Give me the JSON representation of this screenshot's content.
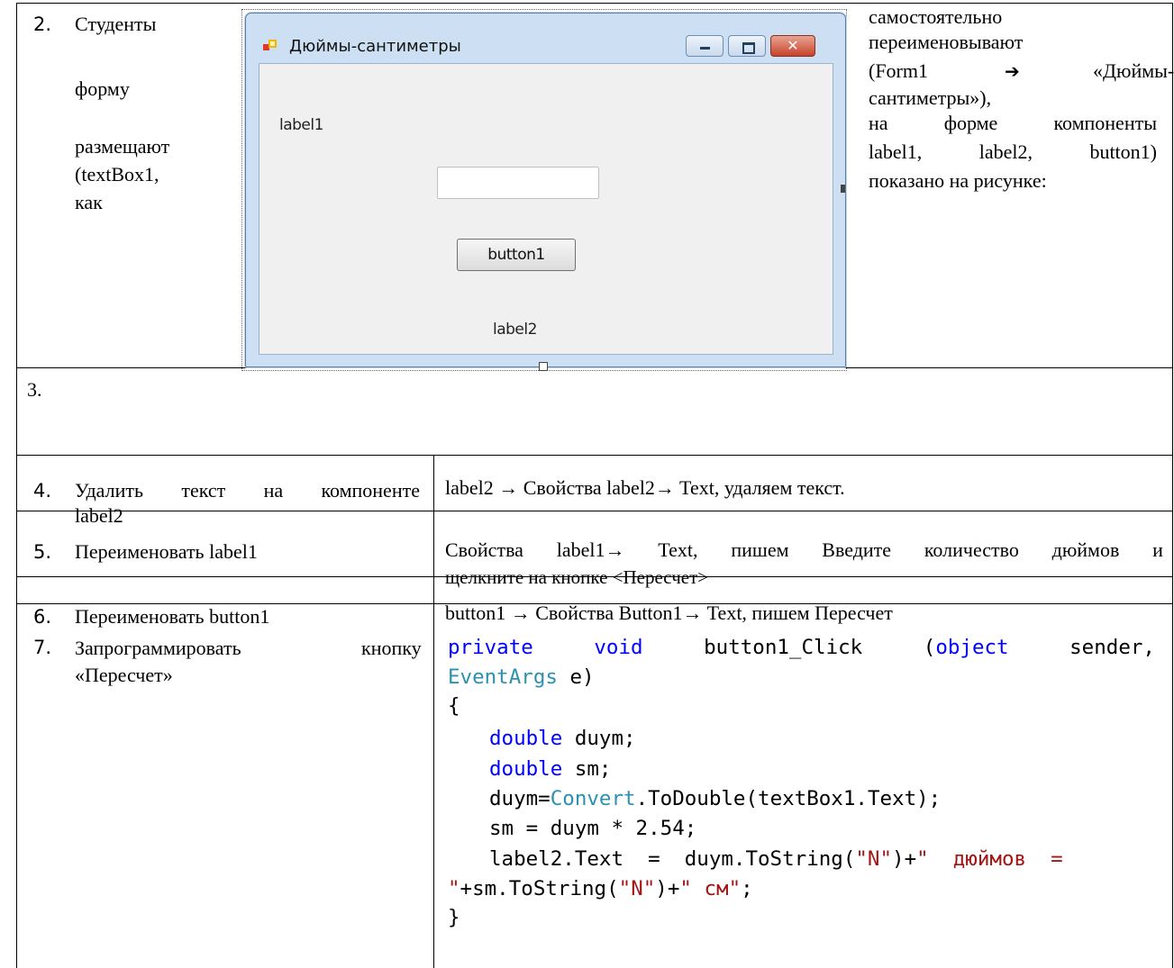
{
  "rows": [
    {
      "num": "2.",
      "left_words": [
        "Студенты",
        "форму",
        "размещают",
        "(textBox1,",
        "как"
      ],
      "right_lines": [
        "самостоятельно",
        "переименовывают"
      ],
      "right_form_open": "(Form1",
      "right_arrow": "➔",
      "right_form_close": "«Дюймы-",
      "right_tail": [
        "сантиметры»),"
      ],
      "right_comp_words": [
        "на",
        "форме",
        "компоненты"
      ],
      "right_comp2_words": [
        "label1,",
        "label2,",
        "button1)"
      ],
      "right_last": "показано на рисунке:"
    },
    {
      "num": "3."
    },
    {
      "num": "4.",
      "task_line1_words": [
        "Удалить",
        "текст",
        "на",
        "компоненте"
      ],
      "task_line2": "label2",
      "action": "label2 → Свойства label2→ Text, удаляем текст."
    },
    {
      "num": "5.",
      "task": "Переименовать label1",
      "action_line1_words": [
        "Свойства",
        "label1→",
        "Text,",
        "пишем",
        "Введите",
        "количество",
        "дюймов",
        "и"
      ],
      "action_line2": "щелкните на кнопке <Пересчет>"
    },
    {
      "num": "6.",
      "task": "Переименовать button1",
      "action": "button1 → Свойства Button1→ Text, пишем Пересчет"
    },
    {
      "num": "7.",
      "task_line1_left": "Запрограммировать",
      "task_line1_right": "кнопку",
      "task_line2": "«Пересчет»"
    }
  ],
  "form": {
    "title": "Дюймы-сантиметры",
    "label1": "label1",
    "button1": "button1",
    "label2": "label2"
  },
  "code": {
    "l1_kw1": "private",
    "l1_kw2": "void",
    "l1_name": "button1_Click",
    "l1_paren": "(object",
    "l1_sender": "sender,",
    "l2_type": "EventArgs",
    "l2_rest": " e)",
    "l3": "{",
    "l4_kw": "double",
    "l4_rest": " duym;",
    "l5_kw": "double",
    "l5_rest": " sm;",
    "l6_a": "duym=",
    "l6_type": "Convert",
    "l6_b": ".ToDouble(textBox1.Text);",
    "l7": "sm = duym * 2.54;",
    "l8_a": "label2.Text  =  duym.ToString(",
    "l8_s1": "\"N\"",
    "l8_b": ")+",
    "l8_s2": "\"  дюймов  =",
    "l9_s": "\"",
    "l9_a": "+sm.ToString(",
    "l9_s2": "\"N\"",
    "l9_b": ")+",
    "l9_s3": "\" см\"",
    "l9_c": ";",
    "l10": "}"
  },
  "colors": {
    "keyword": "#0000ff",
    "type": "#2b91af",
    "string": "#a31515"
  }
}
